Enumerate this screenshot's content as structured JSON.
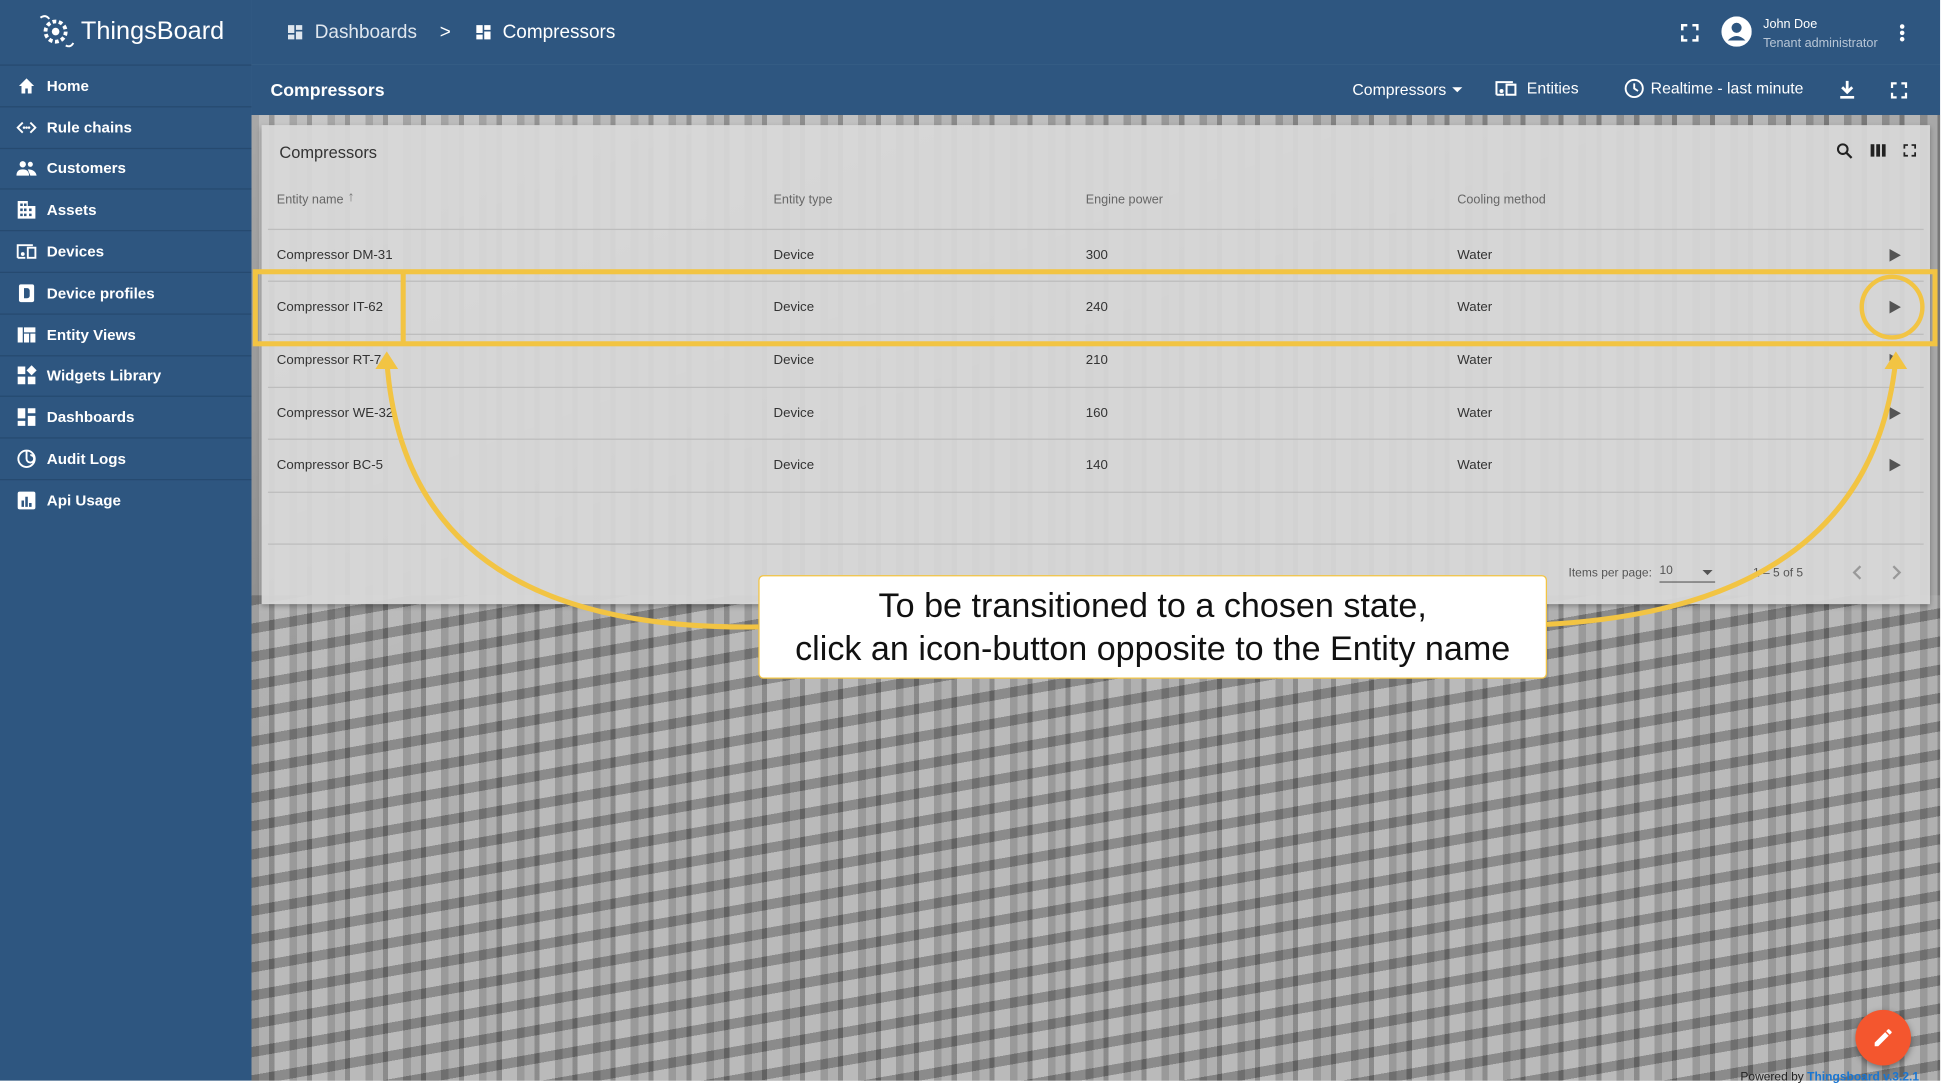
{
  "app": {
    "name": "ThingsBoard"
  },
  "sidebar": {
    "items": [
      {
        "label": "Home",
        "icon": "home-icon"
      },
      {
        "label": "Rule chains",
        "icon": "rule-chains-icon"
      },
      {
        "label": "Customers",
        "icon": "customers-icon"
      },
      {
        "label": "Assets",
        "icon": "assets-icon"
      },
      {
        "label": "Devices",
        "icon": "devices-icon"
      },
      {
        "label": "Device profiles",
        "icon": "device-profiles-icon"
      },
      {
        "label": "Entity Views",
        "icon": "entity-views-icon"
      },
      {
        "label": "Widgets Library",
        "icon": "widgets-icon"
      },
      {
        "label": "Dashboards",
        "icon": "dashboards-icon"
      },
      {
        "label": "Audit Logs",
        "icon": "audit-logs-icon"
      },
      {
        "label": "Api Usage",
        "icon": "api-usage-icon"
      }
    ]
  },
  "breadcrumb": {
    "first": "Dashboards",
    "separator": ">",
    "second": "Compressors"
  },
  "user": {
    "name": "John Doe",
    "role": "Tenant administrator"
  },
  "toolbar": {
    "title": "Compressors",
    "state_select": "Compressors",
    "entities": "Entities",
    "timewindow": "Realtime - last minute"
  },
  "widget": {
    "title": "Compressors",
    "columns": [
      "Entity name",
      "Entity type",
      "Engine power",
      "Cooling method"
    ],
    "rows": [
      [
        "Compressor DM-31",
        "Device",
        "300",
        "Water"
      ],
      [
        "Compressor IT-62",
        "Device",
        "240",
        "Water"
      ],
      [
        "Compressor RT-7",
        "Device",
        "210",
        "Water"
      ],
      [
        "Compressor WE-32",
        "Device",
        "160",
        "Water"
      ],
      [
        "Compressor BC-5",
        "Device",
        "140",
        "Water"
      ]
    ],
    "paginator": {
      "label": "Items per page:",
      "page_size": "10",
      "range": "1 – 5 of 5"
    }
  },
  "callout": {
    "line1": "To be transitioned to a chosen state,",
    "line2": "click an icon-button opposite to the Entity name"
  },
  "footer": {
    "powered": "Powered by",
    "brand": "Thingsboard v.3.2.1"
  },
  "colors": {
    "primary": "#2e5680",
    "accent": "#f2c443",
    "fab": "#f4562e",
    "link": "#1976d2"
  }
}
